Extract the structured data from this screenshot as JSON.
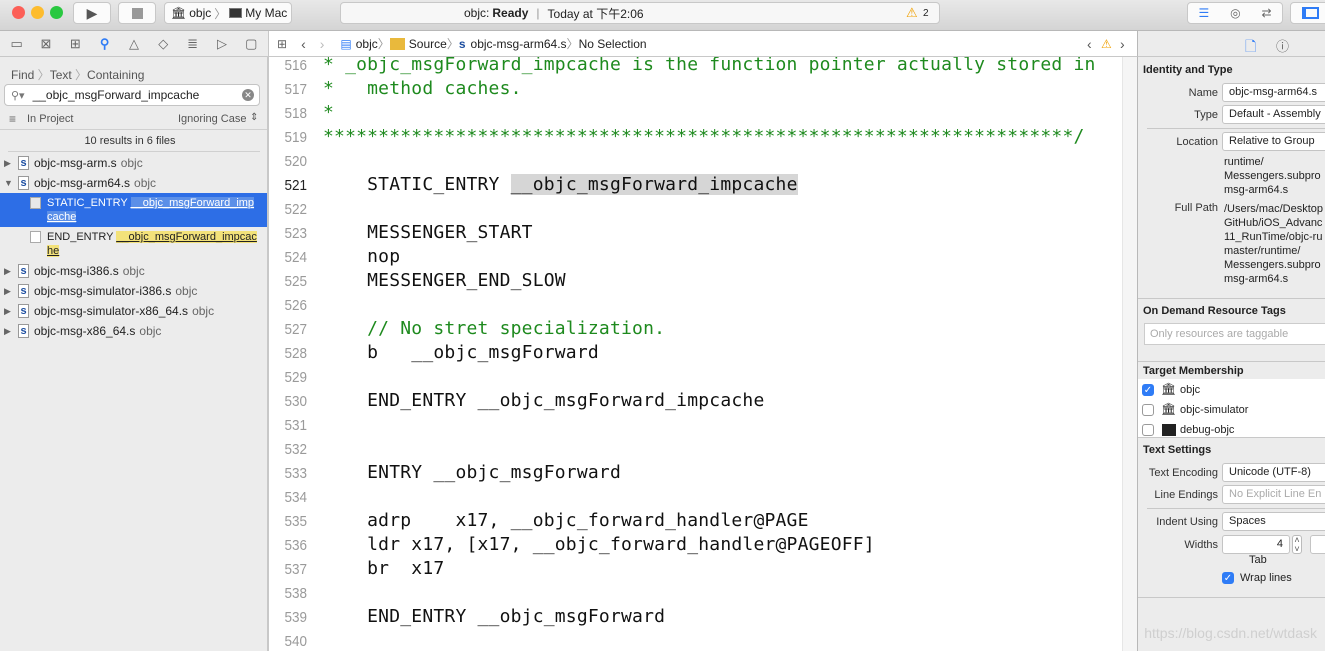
{
  "toolbar": {
    "scheme": "objc",
    "destination": "My Mac",
    "status_project": "objc:",
    "status_state": "Ready",
    "status_time": "Today at 下午2:06",
    "warning_count": "2"
  },
  "navigator": {
    "icons": [
      "folder-icon",
      "source-control-icon",
      "hierarchy-icon",
      "search-icon",
      "warning-icon",
      "test-icon",
      "debug-icon",
      "breakpoint-icon",
      "report-icon"
    ]
  },
  "find": {
    "breadcrumb": [
      "Find",
      "Text",
      "Containing"
    ],
    "query": "__objc_msgForward_impcache",
    "scope": "In Project",
    "case_mode": "Ignoring Case",
    "summary": "10 results in 6 files",
    "files": [
      {
        "name": "objc-msg-arm.s",
        "target": "objc",
        "expanded": false
      },
      {
        "name": "objc-msg-arm64.s",
        "target": "objc",
        "expanded": true,
        "results": [
          {
            "prefix": "STATIC_ENTRY ",
            "match": "__objc_msgForward_imp",
            "match2": "cache",
            "selected": true
          },
          {
            "prefix": "END_ENTRY ",
            "match": "__objc_msgForward_impcac",
            "match2": "he",
            "selected": false
          }
        ]
      },
      {
        "name": "objc-msg-i386.s",
        "target": "objc",
        "expanded": false
      },
      {
        "name": "objc-msg-simulator-i386.s",
        "target": "objc",
        "expanded": false
      },
      {
        "name": "objc-msg-simulator-x86_64.s",
        "target": "objc",
        "expanded": false
      },
      {
        "name": "objc-msg-x86_64.s",
        "target": "objc",
        "expanded": false
      }
    ]
  },
  "jumpbar": {
    "items": [
      "objc",
      "Source",
      "objc-msg-arm64.s",
      "No Selection"
    ]
  },
  "editor": {
    "current_line": "521",
    "lines": [
      {
        "n": "516",
        "text": "* _objc_msgForward_impcache is the function pointer actually stored in",
        "comment": true
      },
      {
        "n": "517",
        "text": "*   method caches.",
        "comment": true
      },
      {
        "n": "518",
        "text": "*",
        "comment": true
      },
      {
        "n": "519",
        "text": "********************************************************************/",
        "comment": true
      },
      {
        "n": "520",
        "text": ""
      },
      {
        "n": "521",
        "text": "    STATIC_ENTRY ",
        "hl": "__objc_msgForward_impcache"
      },
      {
        "n": "522",
        "text": ""
      },
      {
        "n": "523",
        "text": "    MESSENGER_START"
      },
      {
        "n": "524",
        "text": "    nop"
      },
      {
        "n": "525",
        "text": "    MESSENGER_END_SLOW"
      },
      {
        "n": "526",
        "text": ""
      },
      {
        "n": "527",
        "text": "    // No stret specialization.",
        "comment": true
      },
      {
        "n": "528",
        "text": "    b   __objc_msgForward"
      },
      {
        "n": "529",
        "text": ""
      },
      {
        "n": "530",
        "text": "    END_ENTRY __objc_msgForward_impcache"
      },
      {
        "n": "531",
        "text": ""
      },
      {
        "n": "532",
        "text": ""
      },
      {
        "n": "533",
        "text": "    ENTRY __objc_msgForward"
      },
      {
        "n": "534",
        "text": ""
      },
      {
        "n": "535",
        "text": "    adrp    x17, __objc_forward_handler@PAGE"
      },
      {
        "n": "536",
        "text": "    ldr x17, [x17, __objc_forward_handler@PAGEOFF]"
      },
      {
        "n": "537",
        "text": "    br  x17"
      },
      {
        "n": "538",
        "text": ""
      },
      {
        "n": "539",
        "text": "    END_ENTRY __objc_msgForward"
      },
      {
        "n": "540",
        "text": ""
      }
    ]
  },
  "inspector": {
    "identity_title": "Identity and Type",
    "name_label": "Name",
    "name_value": "objc-msg-arm64.s",
    "type_label": "Type",
    "type_value": "Default - Assembly",
    "location_label": "Location",
    "location_value": "Relative to Group",
    "location_path": [
      "runtime/",
      "Messengers.subpro",
      "msg-arm64.s"
    ],
    "fullpath_label": "Full Path",
    "fullpath": [
      "/Users/mac/Desktop",
      "GitHub/iOS_Advanc",
      "11_RunTime/objc-ru",
      "master/runtime/",
      "Messengers.subpro",
      "msg-arm64.s"
    ],
    "odr_title": "On Demand Resource Tags",
    "odr_placeholder": "Only resources are taggable",
    "target_title": "Target Membership",
    "targets": [
      {
        "name": "objc",
        "checked": true
      },
      {
        "name": "objc-simulator",
        "checked": false
      },
      {
        "name": "debug-objc",
        "checked": false
      }
    ],
    "text_title": "Text Settings",
    "encoding_label": "Text Encoding",
    "encoding_value": "Unicode (UTF-8)",
    "endings_label": "Line Endings",
    "endings_value": "No Explicit Line En",
    "indent_label": "Indent Using",
    "indent_value": "Spaces",
    "widths_label": "Widths",
    "tab_width": "4",
    "tab_label": "Tab",
    "wrap_label": "Wrap lines",
    "wrap_checked": true
  },
  "watermark": "https://blog.csdn.net/wtdask",
  "colors": {
    "accent": "#2f7cf6",
    "comment": "#1e8a1e",
    "match_highlight": "#f3e27a",
    "selection": "#2d6ee6"
  }
}
